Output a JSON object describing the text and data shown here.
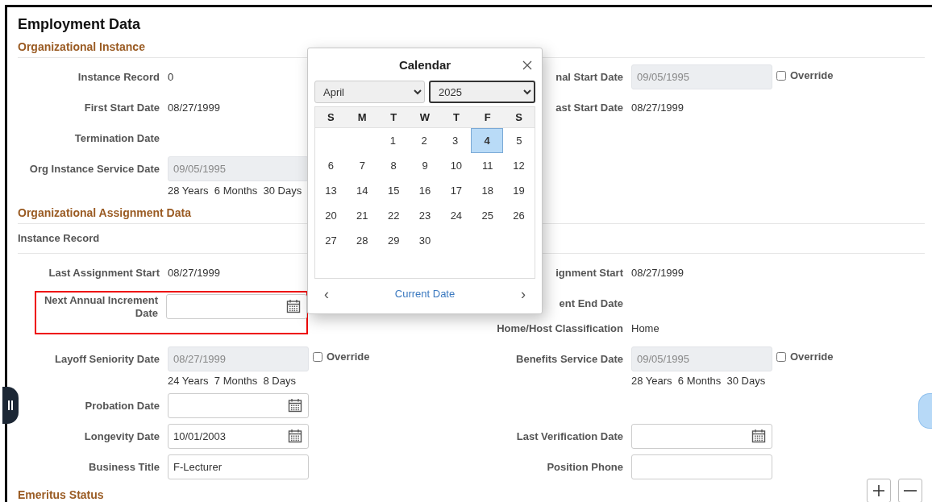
{
  "title": "Employment Data",
  "sections": [
    {
      "heading": "Organizational Instance",
      "rows": [
        {
          "left": [
            {
              "label": "Instance Record",
              "kind": "text",
              "value": "0"
            }
          ],
          "right": [
            {
              "label": "nal Start Date",
              "kind": "locked",
              "value": "09/05/1995",
              "override": {
                "label": "Override",
                "checked": false
              }
            }
          ]
        },
        {
          "left": [
            {
              "label": "First Start Date",
              "kind": "text",
              "value": "08/27/1999"
            }
          ],
          "right": [
            {
              "label": "ast Start Date",
              "kind": "text",
              "value": "08/27/1999"
            }
          ]
        },
        {
          "left": [
            {
              "label": "Termination Date",
              "kind": "text"
            }
          ],
          "right": []
        },
        {
          "left": [
            {
              "label": "Org Instance Service Date",
              "kind": "locked",
              "value": "09/05/1995",
              "duration": "28 Years  6 Months  30 Days"
            }
          ],
          "right": []
        }
      ]
    },
    {
      "heading": "Organizational Assignment Data",
      "subheading": "Instance Record",
      "rows": [
        {
          "left": [
            {
              "label": "Last Assignment Start",
              "kind": "text",
              "value": "08/27/1999"
            }
          ],
          "right": [
            {
              "label": "ignment Start",
              "kind": "text",
              "value": "08/27/1999"
            }
          ]
        },
        {
          "left": [
            {
              "label": "Next Annual Increment Date",
              "kind": "date",
              "highlighted": true
            }
          ],
          "right": [
            {
              "label": "ent End Date",
              "kind": "text"
            },
            {
              "label": "Home/Host Classification",
              "kind": "text",
              "value": "Home"
            }
          ]
        },
        {
          "left": [
            {
              "label": "Layoff Seniority Date",
              "kind": "locked",
              "value": "08/27/1999",
              "duration": "24 Years  7 Months  8 Days",
              "override": {
                "label": "Override",
                "checked": false
              }
            }
          ],
          "right": [
            {
              "label": "Benefits Service Date",
              "kind": "locked",
              "value": "09/05/1995",
              "duration": "28 Years  6 Months  30 Days",
              "override": {
                "label": "Override",
                "checked": false
              }
            }
          ]
        },
        {
          "left": [
            {
              "label": "Probation Date",
              "kind": "date"
            }
          ],
          "right": []
        },
        {
          "left": [
            {
              "label": "Longevity Date",
              "kind": "date",
              "value": "10/01/2003"
            }
          ],
          "right": [
            {
              "label": "Last Verification Date",
              "kind": "date"
            }
          ]
        },
        {
          "left": [
            {
              "label": "Business Title",
              "kind": "input",
              "value": "F-Lecturer"
            }
          ],
          "right": [
            {
              "label": "Position Phone",
              "kind": "input"
            }
          ]
        }
      ]
    },
    {
      "heading": "Emeritus Status"
    }
  ],
  "calendar": {
    "title": "Calendar",
    "month": {
      "value": "April",
      "focused": false
    },
    "year": {
      "value": "2025",
      "focused": true
    },
    "weekdays": [
      "S",
      "M",
      "T",
      "W",
      "T",
      "F",
      "S"
    ],
    "weeks": [
      [
        {
          "kind": "blank"
        },
        {
          "kind": "blank"
        },
        {
          "kind": "day",
          "day": "1",
          "selected": false
        },
        {
          "kind": "day",
          "day": "2",
          "selected": false
        },
        {
          "kind": "day",
          "day": "3",
          "selected": false
        },
        {
          "kind": "day",
          "day": "4",
          "selected": true
        },
        {
          "kind": "day",
          "day": "5",
          "selected": false
        }
      ],
      [
        {
          "kind": "day",
          "day": "6",
          "selected": false
        },
        {
          "kind": "day",
          "day": "7",
          "selected": false
        },
        {
          "kind": "day",
          "day": "8",
          "selected": false
        },
        {
          "kind": "day",
          "day": "9",
          "selected": false
        },
        {
          "kind": "day",
          "day": "10",
          "selected": false
        },
        {
          "kind": "day",
          "day": "11",
          "selected": false
        },
        {
          "kind": "day",
          "day": "12",
          "selected": false
        }
      ],
      [
        {
          "kind": "day",
          "day": "13",
          "selected": false
        },
        {
          "kind": "day",
          "day": "14",
          "selected": false
        },
        {
          "kind": "day",
          "day": "15",
          "selected": false
        },
        {
          "kind": "day",
          "day": "16",
          "selected": false
        },
        {
          "kind": "day",
          "day": "17",
          "selected": false
        },
        {
          "kind": "day",
          "day": "18",
          "selected": false
        },
        {
          "kind": "day",
          "day": "19",
          "selected": false
        }
      ],
      [
        {
          "kind": "day",
          "day": "20",
          "selected": false
        },
        {
          "kind": "day",
          "day": "21",
          "selected": false
        },
        {
          "kind": "day",
          "day": "22",
          "selected": false
        },
        {
          "kind": "day",
          "day": "23",
          "selected": false
        },
        {
          "kind": "day",
          "day": "24",
          "selected": false
        },
        {
          "kind": "day",
          "day": "25",
          "selected": false
        },
        {
          "kind": "day",
          "day": "26",
          "selected": false
        }
      ],
      [
        {
          "kind": "day",
          "day": "27",
          "selected": false
        },
        {
          "kind": "day",
          "day": "28",
          "selected": false
        },
        {
          "kind": "day",
          "day": "29",
          "selected": false
        },
        {
          "kind": "day",
          "day": "30",
          "selected": false
        },
        {
          "kind": "blank"
        },
        {
          "kind": "blank"
        },
        {
          "kind": "blank"
        }
      ]
    ],
    "prev": "‹",
    "next": "›",
    "today_link": "Current Date"
  }
}
